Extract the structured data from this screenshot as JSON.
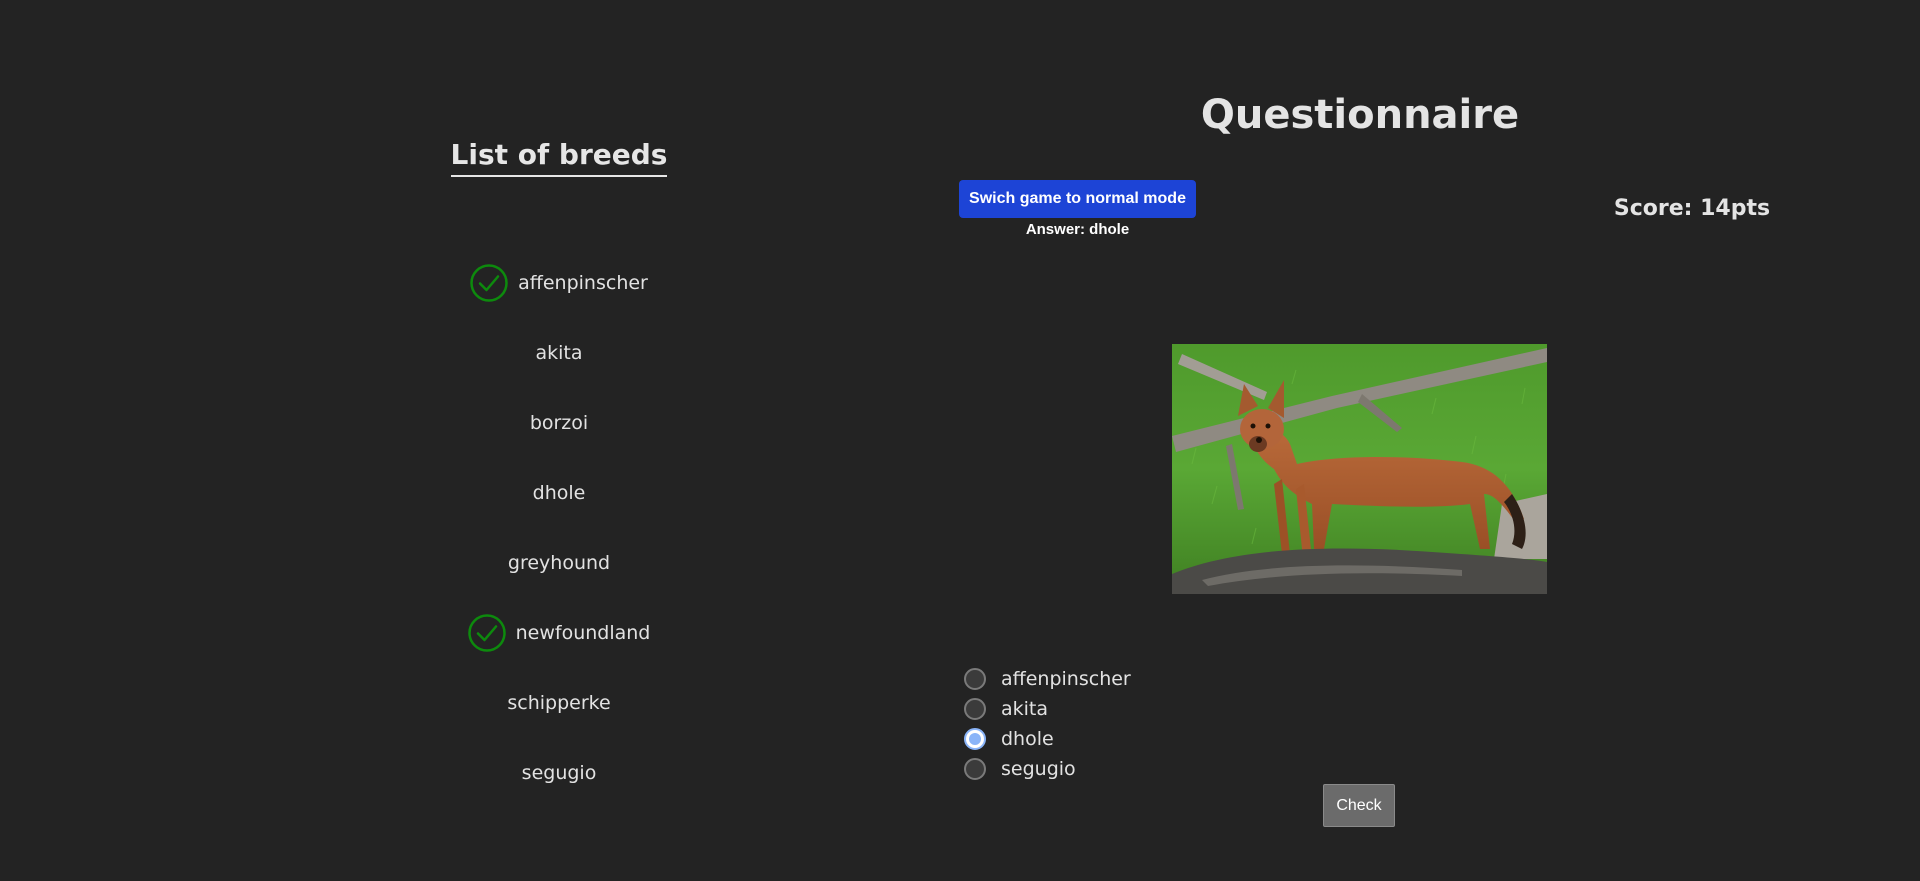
{
  "breeds_panel": {
    "title": "List of breeds",
    "items": [
      {
        "label": "affenpinscher",
        "checked": true
      },
      {
        "label": "akita",
        "checked": false
      },
      {
        "label": "borzoi",
        "checked": false
      },
      {
        "label": "dhole",
        "checked": false
      },
      {
        "label": "greyhound",
        "checked": false
      },
      {
        "label": "newfoundland",
        "checked": true
      },
      {
        "label": "schipperke",
        "checked": false
      },
      {
        "label": "segugio",
        "checked": false
      }
    ],
    "check_color": "#0d8a0d"
  },
  "quiz": {
    "title": "Questionnaire",
    "mode_button_label": "Swich game to normal mode",
    "answer_text": "Answer: dhole",
    "score_text": "Score: 14pts",
    "photo_icon": "dog-photo",
    "options": [
      {
        "label": "affenpinscher",
        "selected": false
      },
      {
        "label": "akita",
        "selected": false
      },
      {
        "label": "dhole",
        "selected": true
      },
      {
        "label": "segugio",
        "selected": false
      }
    ],
    "check_button_label": "Check"
  },
  "colors": {
    "background": "#232323",
    "primary_button": "#1d44d6",
    "secondary_button": "#6b6b6b",
    "radio_selected": "#8ab4f8"
  }
}
